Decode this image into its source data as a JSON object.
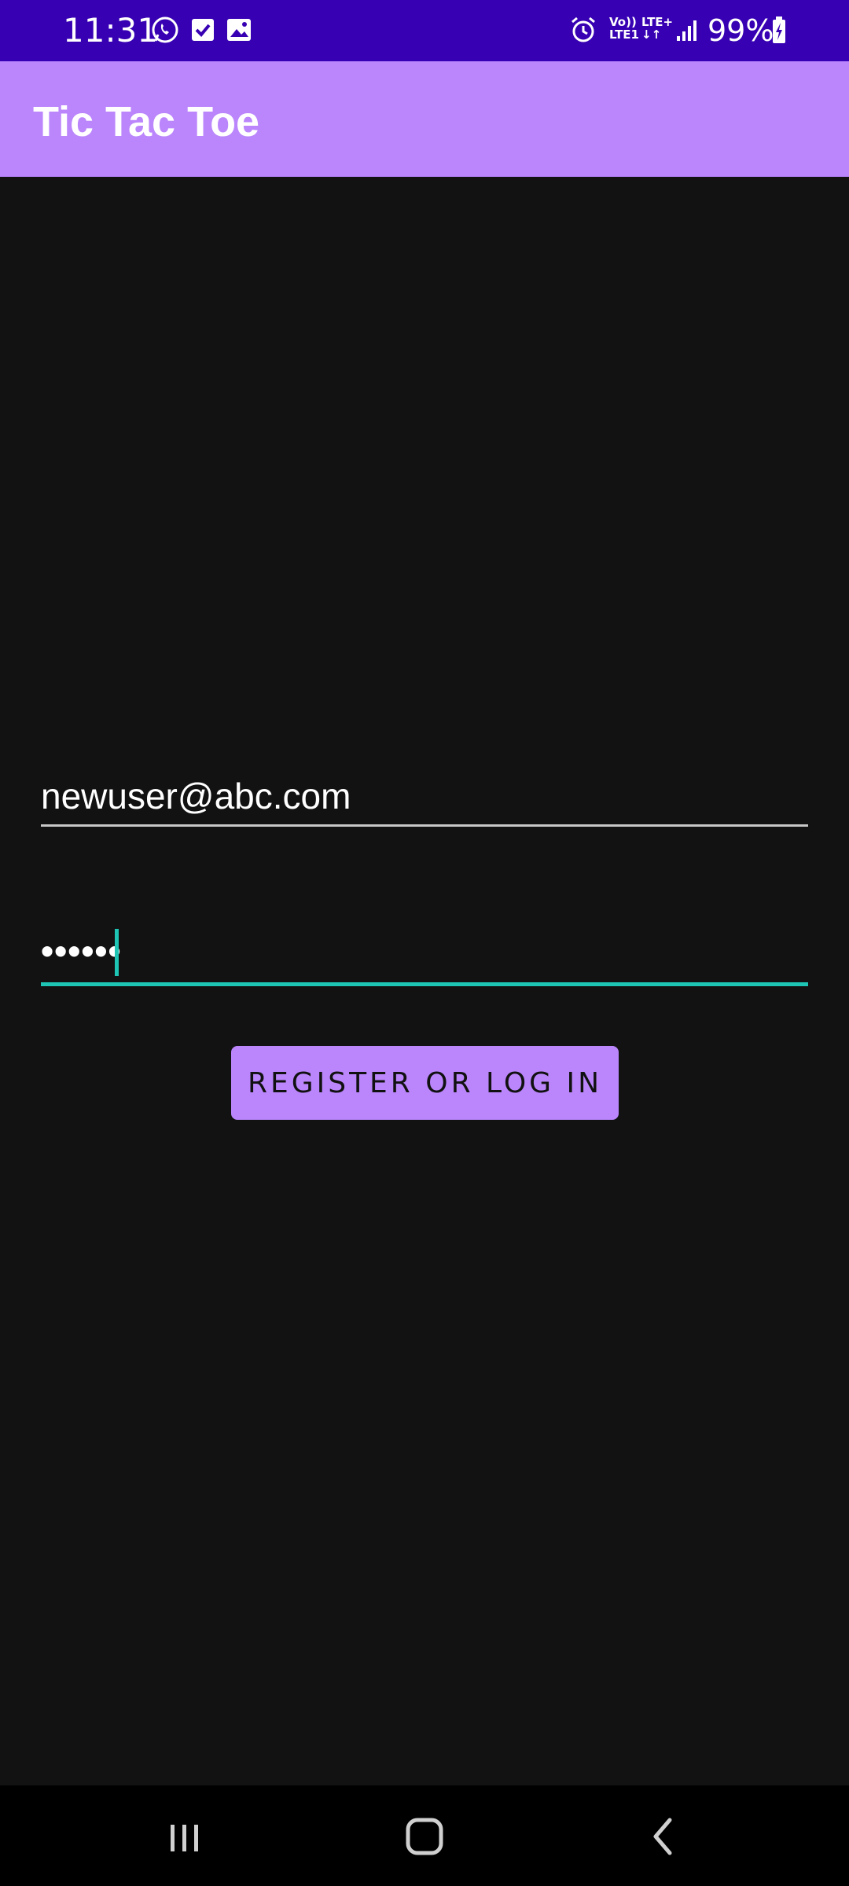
{
  "status_bar": {
    "time": "11:31",
    "notification_icons": [
      "whatsapp-icon",
      "checkbox-icon",
      "image-icon"
    ],
    "right_icons": [
      "alarm-icon",
      "volte-icon",
      "lte-icon",
      "signal-icon",
      "battery-charging-icon"
    ],
    "volte_label_top": "Vo))",
    "volte_label_bottom": "LTE1",
    "lte_label": "LTE+",
    "battery": "99%"
  },
  "app_bar": {
    "title": "Tic Tac Toe"
  },
  "form": {
    "email_value": "newuser@abc.com",
    "password_masked": "••••••",
    "submit_label": "REGISTER OR LOG IN"
  },
  "nav_bar": {
    "buttons": [
      "recents-icon",
      "home-icon",
      "back-icon"
    ]
  },
  "colors": {
    "status_bar": "#3700b3",
    "primary": "#bb86fc",
    "background": "#121212",
    "focus_accent": "#1ec4b4"
  }
}
